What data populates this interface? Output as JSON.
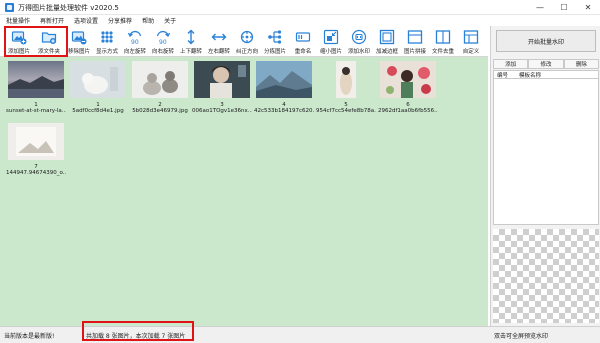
{
  "window": {
    "title": "万得图片批量处理软件 v2020.5",
    "controls": [
      "—",
      "☐",
      "✕"
    ]
  },
  "menu": [
    "批量操作",
    "再新打开",
    "选项设置",
    "分享推荐",
    "帮助",
    "关于"
  ],
  "toolbar": {
    "buttons": [
      {
        "label": "添加图片",
        "icon": "add-image-icon"
      },
      {
        "label": "添文件夹",
        "icon": "add-folder-icon"
      },
      {
        "label": "移除图片",
        "icon": "remove-image-icon"
      },
      {
        "label": "显示方式",
        "icon": "grid-view-icon"
      },
      {
        "label": "向左旋转",
        "icon": "rotate-left-icon"
      },
      {
        "label": "向右旋转",
        "icon": "rotate-right-icon"
      },
      {
        "label": "上下翻转",
        "icon": "flip-vertical-icon"
      },
      {
        "label": "左右翻转",
        "icon": "flip-horizontal-icon"
      },
      {
        "label": "纠正方向",
        "icon": "correct-direction-icon"
      },
      {
        "label": "分拣图片",
        "icon": "sort-images-icon"
      },
      {
        "label": "重命名",
        "icon": "rename-icon"
      },
      {
        "label": "缩小图片",
        "icon": "shrink-image-icon"
      },
      {
        "label": "添加水印",
        "icon": "watermark-icon"
      },
      {
        "label": "加减边框",
        "icon": "border-icon"
      },
      {
        "label": "图片拼接",
        "icon": "stitch-icon"
      },
      {
        "label": "文件去重",
        "icon": "dedupe-icon"
      },
      {
        "label": "自定义",
        "icon": "custom-icon"
      }
    ]
  },
  "thumbnails": [
    {
      "num": "1",
      "name": "sunset-at-st-mary-la..."
    },
    {
      "num": "1",
      "name": "5adf0ccf8d4e1.jpg"
    },
    {
      "num": "2",
      "name": "5b028d3e46979.jpg"
    },
    {
      "num": "3",
      "name": "006ao1TOgv1e36nx..."
    },
    {
      "num": "4",
      "name": "42c533b184197c620..."
    },
    {
      "num": "5",
      "name": "954cf7cc54efe8b78a..."
    },
    {
      "num": "6",
      "name": "2962df1aa0b6fb556..."
    },
    {
      "num": "7",
      "name": "144947.94674390_o..."
    }
  ],
  "right_panel": {
    "batch_button": "开始批量水印",
    "tabs": [
      "添加",
      "修改",
      "删除"
    ],
    "columns": [
      "编号",
      "模板名称"
    ]
  },
  "status": {
    "left": "当前版本是最新版!",
    "center": "共加载 8 张图片，本次加载 7 张图片",
    "right": "双击可全屏预览水印"
  },
  "colors": {
    "main_bg": "#cbe8cd",
    "icon_blue": "#2a82d8",
    "highlight_red": "#e01414"
  }
}
